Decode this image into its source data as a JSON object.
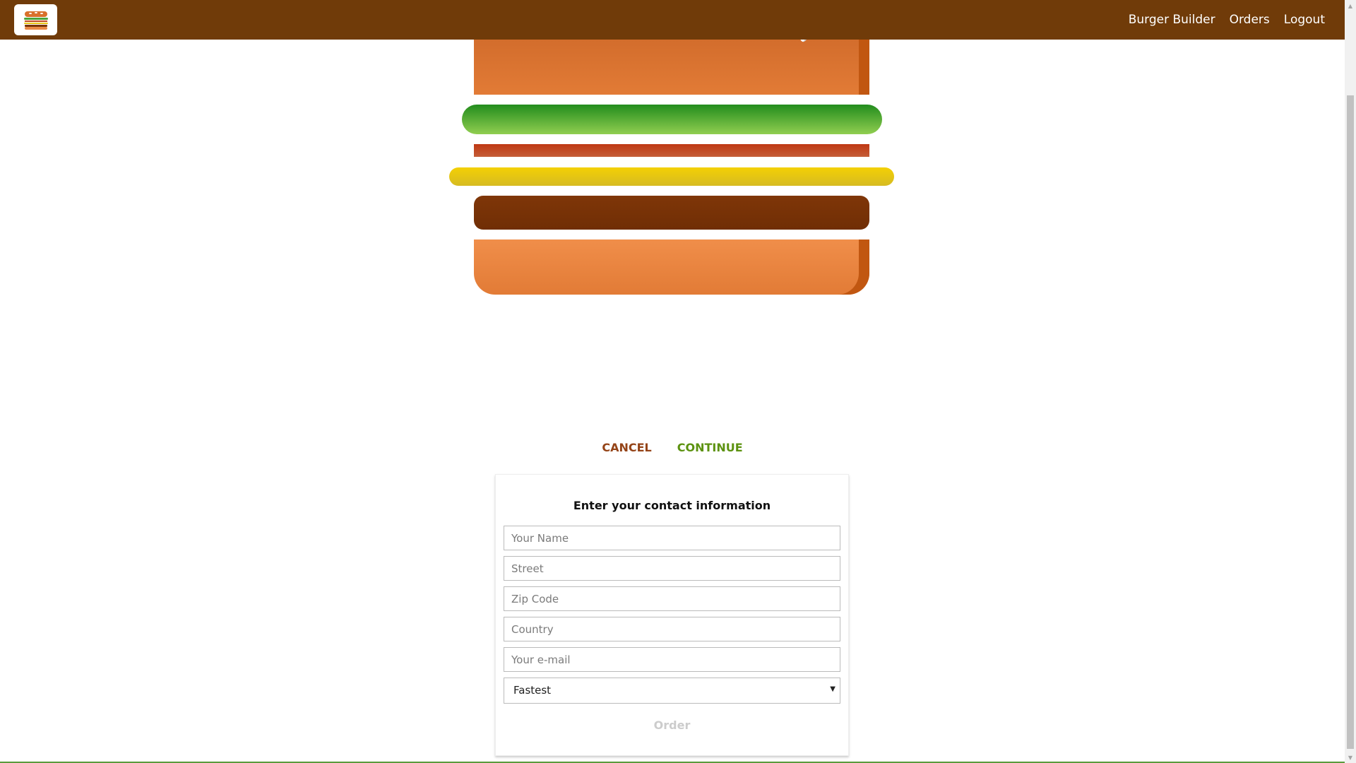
{
  "toolbar": {
    "logo_alt": "burger-logo",
    "nav": [
      {
        "label": "Burger Builder"
      },
      {
        "label": "Orders"
      },
      {
        "label": "Logout"
      }
    ]
  },
  "burger": {
    "layers": [
      "bread-top",
      "salad",
      "bacon",
      "cheese",
      "meat",
      "bread-bottom"
    ]
  },
  "actions": {
    "cancel_label": "CANCEL",
    "continue_label": "CONTINUE"
  },
  "contact_form": {
    "title": "Enter your contact information",
    "fields": [
      {
        "placeholder": "Your Name",
        "value": ""
      },
      {
        "placeholder": "Street",
        "value": ""
      },
      {
        "placeholder": "Zip Code",
        "value": ""
      },
      {
        "placeholder": "Country",
        "value": ""
      },
      {
        "placeholder": "Your e-mail",
        "value": ""
      }
    ],
    "delivery_method": {
      "selected": "Fastest"
    },
    "order_label": "Order"
  },
  "colors": {
    "toolbar": "#703b09",
    "cancel": "#944317",
    "continue": "#5c9210",
    "order_disabled": "#cccccc"
  }
}
